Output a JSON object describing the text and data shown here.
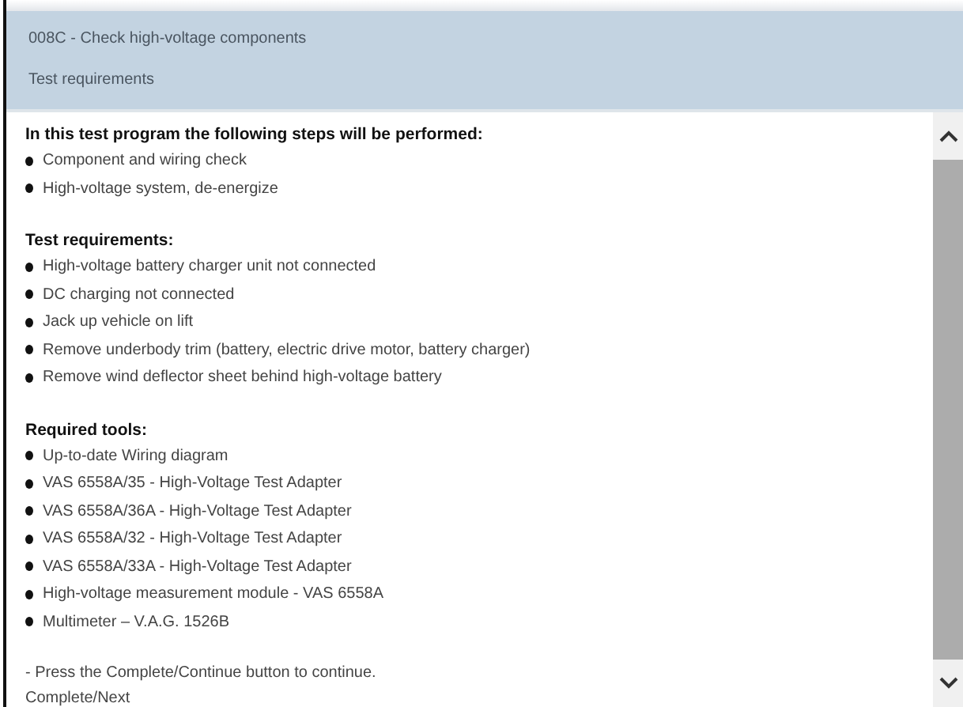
{
  "header": {
    "title": "008C - Check high-voltage components",
    "subtitle": "Test requirements"
  },
  "sections": [
    {
      "heading": "In this test program the following steps will be performed:",
      "items": [
        "Component and wiring check",
        "High-voltage system, de-energize"
      ]
    },
    {
      "heading": "Test requirements:",
      "items": [
        "High-voltage battery charger unit not connected",
        "DC charging not connected",
        "Jack up vehicle on lift",
        "Remove underbody trim (battery, electric drive motor, battery charger)",
        "Remove wind deflector sheet behind high-voltage battery"
      ]
    },
    {
      "heading": "Required tools:",
      "items": [
        "Up-to-date Wiring diagram",
        "VAS 6558A/35 - High-Voltage Test Adapter",
        "VAS 6558A/36A - High-Voltage Test Adapter",
        "VAS 6558A/32 - High-Voltage Test Adapter",
        "VAS 6558A/33A - High-Voltage Test Adapter",
        "High-voltage measurement module - VAS 6558A",
        "Multimeter – V.A.G. 1526B"
      ]
    }
  ],
  "footer": [
    "- Press the Complete/Continue button to continue.",
    "Complete/Next"
  ]
}
